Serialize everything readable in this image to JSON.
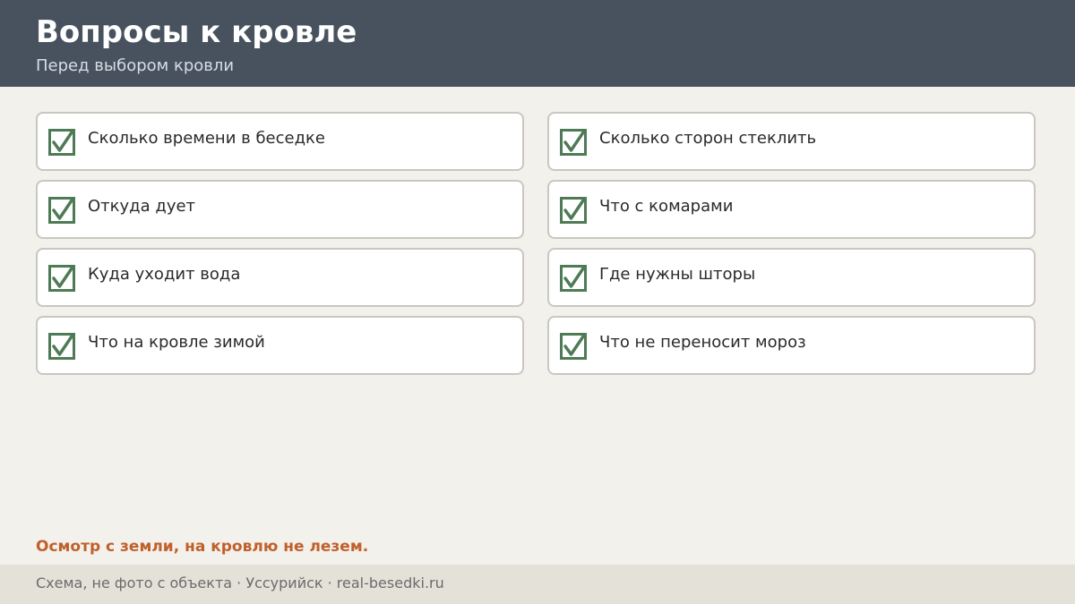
{
  "header": {
    "title": "Вопросы к кровле",
    "subtitle": "Перед выбором кровли"
  },
  "checklist": [
    {
      "label": "Сколько времени в беседке",
      "checked": true
    },
    {
      "label": "Сколько сторон стеклить",
      "checked": true
    },
    {
      "label": "Откуда дует",
      "checked": true
    },
    {
      "label": "Что с комарами",
      "checked": true
    },
    {
      "label": "Куда уходит вода",
      "checked": true
    },
    {
      "label": "Где нужны шторы",
      "checked": true
    },
    {
      "label": "Что на кровле зимой",
      "checked": true
    },
    {
      "label": "Что не переносит мороз",
      "checked": true
    }
  ],
  "note": "Осмотр с земли, на кровлю не лезем.",
  "footer": {
    "text": "Схема, не фото с объекта  ·  Уссурийск  ·  real-besedki.ru"
  },
  "colors": {
    "header_bg": "#48525e",
    "check_green": "#4e7a55",
    "note_accent": "#c0602b"
  },
  "icons": {
    "check": "checkbox-checked-icon"
  }
}
